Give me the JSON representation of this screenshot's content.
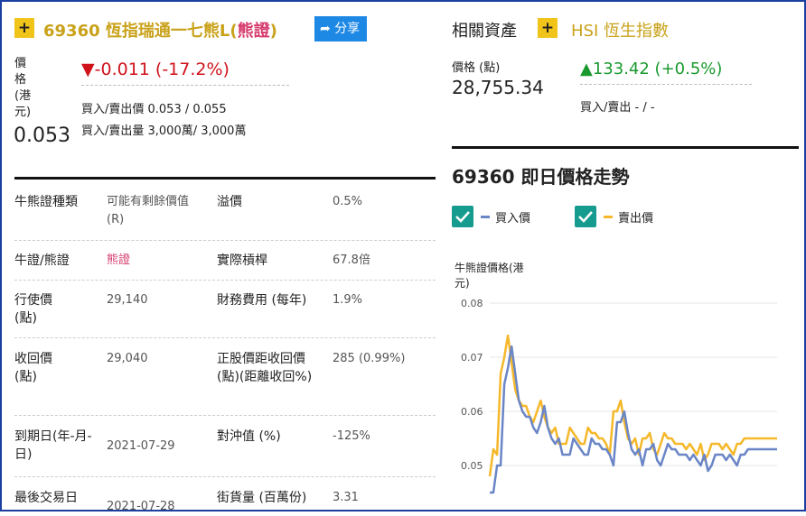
{
  "header": {
    "title": "69360 恆指瑞通一七熊L",
    "type_label": "熊證",
    "share_label": "分享"
  },
  "price": {
    "label": "價格(港元)",
    "value": "0.053",
    "change": "-0.011 (-17.2%)",
    "bid_ask_price": "買入/賣出價 0.053 / 0.055",
    "bid_ask_volume": "買入/賣出量 3,000萬/ 3,000萬"
  },
  "related": {
    "title": "相關資產",
    "asset_name": "HSI 恆生指數",
    "price_label": "價格 (點)",
    "price_value": "28,755.34",
    "change": "133.42 (+0.5%)",
    "bid_ask": "買入/賣出 - / -"
  },
  "details": [
    {
      "label": "牛熊證種類",
      "value": "可能有剩餘價值(R)",
      "label2": "溢價",
      "value2": "0.5%"
    },
    {
      "label": "牛證/熊證",
      "value": "熊證",
      "label2": "實際槓桿",
      "value2": "67.8倍"
    },
    {
      "label": "行使價(點)",
      "value": "29,140",
      "label2": "財務費用 (每年)",
      "value2": "1.9%"
    },
    {
      "label": "收回價(點)",
      "value": "29,040",
      "label2": "正股價距收回價(點)(距離收回%)",
      "value2": "285 (0.99%)"
    },
    {
      "label": "到期日(年-月-日)",
      "value": "2021-07-29",
      "label2": "對沖值 (%)",
      "value2": "-125%"
    },
    {
      "label": "最後交易日",
      "value": "2021-07-28",
      "label2": "街貨量 (百萬份)",
      "value2": "3.31"
    }
  ],
  "chart_section": {
    "title": "69360 即日價格走勢",
    "legend_bid": "買入價",
    "legend_ask": "賣出價",
    "colors": {
      "bid": "#6b86c6",
      "ask": "#f5b82a",
      "check": "#169b8f"
    }
  },
  "chart_data": {
    "type": "line",
    "ylabel": "牛熊證價格(港元)",
    "yticks": [
      "0.08",
      "0.07",
      "0.06",
      "0.05"
    ],
    "ylim": [
      0.046,
      0.08
    ],
    "grid": true,
    "series": [
      {
        "name": "買入價",
        "values": [
          0.045,
          0.045,
          0.05,
          0.05,
          0.065,
          0.068,
          0.072,
          0.067,
          0.062,
          0.06,
          0.059,
          0.059,
          0.057,
          0.056,
          0.058,
          0.061,
          0.057,
          0.055,
          0.054,
          0.055,
          0.052,
          0.052,
          0.052,
          0.055,
          0.054,
          0.053,
          0.052,
          0.052,
          0.055,
          0.054,
          0.054,
          0.053,
          0.053,
          0.052,
          0.05,
          0.058,
          0.058,
          0.06,
          0.056,
          0.053,
          0.052,
          0.053,
          0.05,
          0.053,
          0.053,
          0.054,
          0.051,
          0.05,
          0.052,
          0.054,
          0.053,
          0.053,
          0.052,
          0.052,
          0.052,
          0.051,
          0.052,
          0.051,
          0.05,
          0.052,
          0.049,
          0.05,
          0.052,
          0.052,
          0.052,
          0.051,
          0.052,
          0.051,
          0.05,
          0.052,
          0.052,
          0.053,
          0.053,
          0.053,
          0.053,
          0.053,
          0.053,
          0.053,
          0.053,
          0.053
        ]
      },
      {
        "name": "賣出價",
        "values": [
          0.048,
          0.053,
          0.052,
          0.067,
          0.07,
          0.074,
          0.069,
          0.064,
          0.062,
          0.061,
          0.061,
          0.059,
          0.058,
          0.06,
          0.062,
          0.059,
          0.057,
          0.056,
          0.057,
          0.054,
          0.054,
          0.054,
          0.057,
          0.056,
          0.055,
          0.054,
          0.054,
          0.057,
          0.056,
          0.056,
          0.055,
          0.055,
          0.054,
          0.052,
          0.06,
          0.06,
          0.062,
          0.058,
          0.055,
          0.054,
          0.055,
          0.052,
          0.055,
          0.055,
          0.056,
          0.053,
          0.052,
          0.054,
          0.056,
          0.055,
          0.055,
          0.054,
          0.054,
          0.054,
          0.053,
          0.054,
          0.053,
          0.052,
          0.054,
          0.051,
          0.052,
          0.054,
          0.054,
          0.054,
          0.053,
          0.054,
          0.053,
          0.052,
          0.054,
          0.054,
          0.055,
          0.055,
          0.055,
          0.055,
          0.055,
          0.055,
          0.055,
          0.055,
          0.055,
          0.055
        ]
      }
    ]
  }
}
